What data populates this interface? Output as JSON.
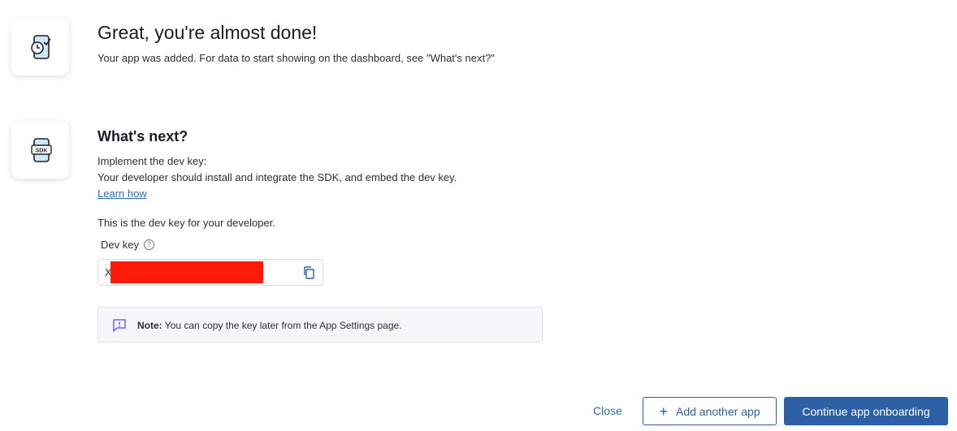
{
  "header": {
    "title": "Great, you're almost done!",
    "subtitle": "Your app was added. For data to start showing on the dashboard, see \"What's next?\""
  },
  "next": {
    "heading": "What's next?",
    "line1": "Implement the dev key:",
    "line2": "Your developer should install and integrate the SDK, and embed the dev key.",
    "learn_link": "Learn how",
    "dev_key_intro": "This is the dev key for your developer."
  },
  "dev_key": {
    "label": "Dev key",
    "help_glyph": "?",
    "value_visible_prefix": "X",
    "icons": {
      "help": "help-circle-icon",
      "copy": "copy-icon"
    }
  },
  "note": {
    "label": "Note:",
    "text": "You can copy the key later from the App Settings page.",
    "icon": "message-alert-icon"
  },
  "icons": {
    "step1": "phone-clock-icon",
    "step2": "sdk-icon"
  },
  "footer": {
    "close": "Close",
    "add_another": "Add another app",
    "add_glyph": "+",
    "continue": "Continue app onboarding"
  },
  "colors": {
    "primary": "#2d5fa6",
    "link": "#2d6cb5",
    "redaction": "#ff1a0a",
    "note_icon": "#7b5cff"
  }
}
